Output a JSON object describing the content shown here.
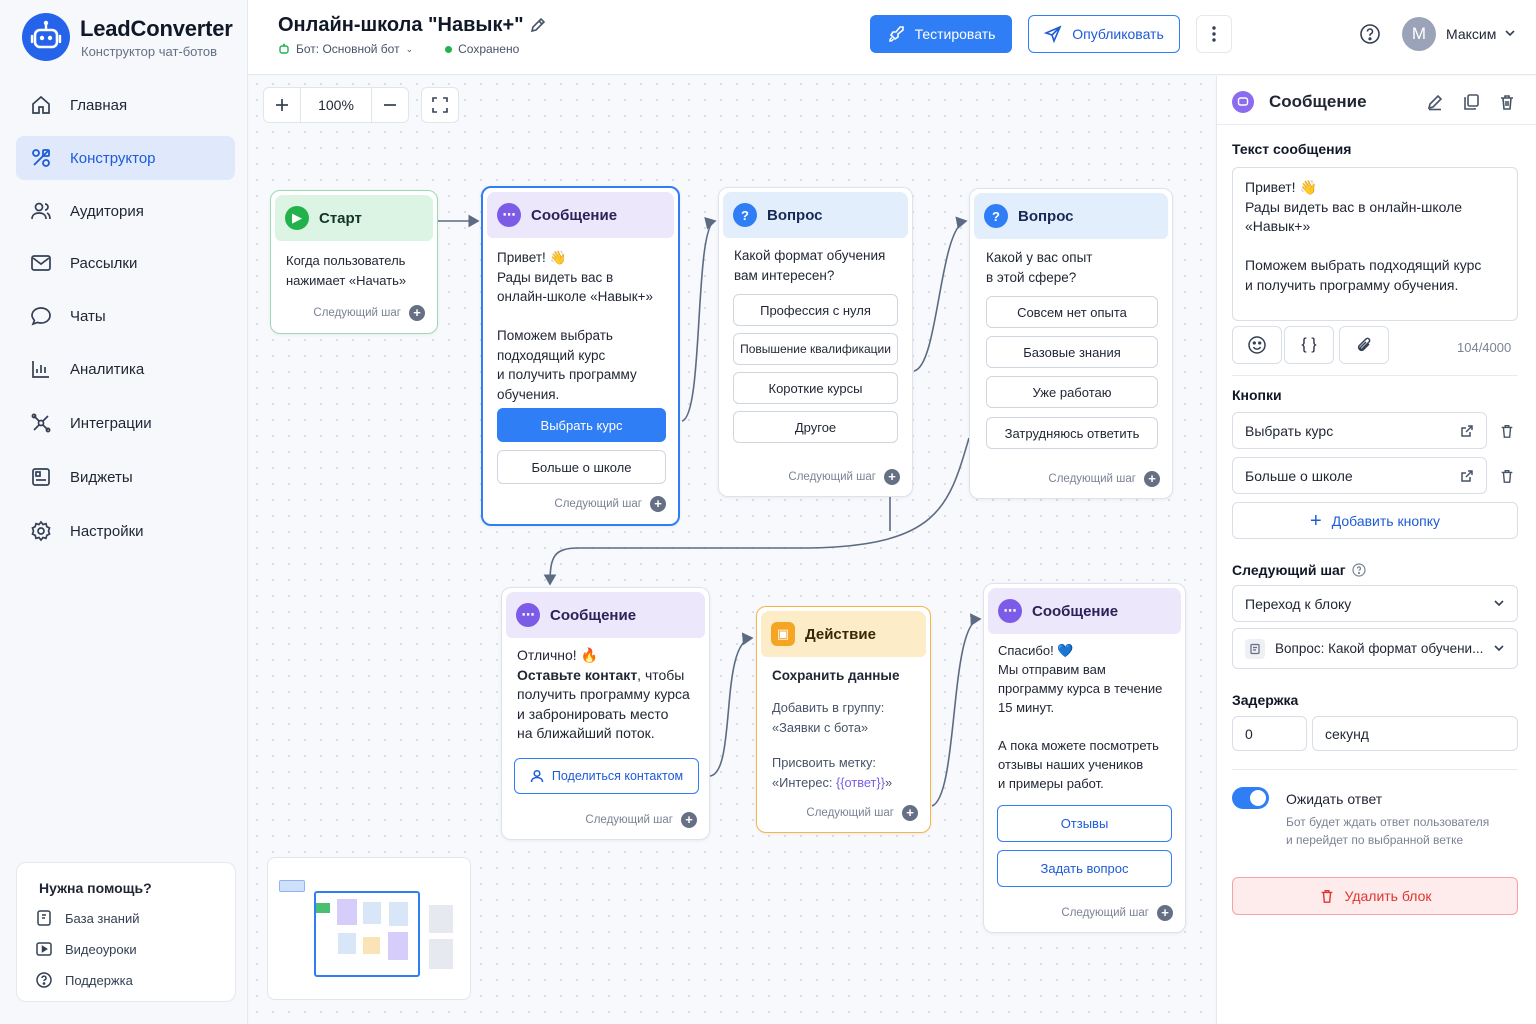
{
  "app": {
    "brand": "LeadConverter",
    "subtitle": "Конструктор чат-ботов"
  },
  "nav": [
    {
      "label": "Главная",
      "icon": "home-icon"
    },
    {
      "label": "Конструктор",
      "icon": "constructor-icon",
      "active": true
    },
    {
      "label": "Аудитория",
      "icon": "users-icon"
    },
    {
      "label": "Рассылки",
      "icon": "mail-icon"
    },
    {
      "label": "Чаты",
      "icon": "chat-icon"
    },
    {
      "label": "Аналитика",
      "icon": "chart-icon"
    },
    {
      "label": "Интеграции",
      "icon": "integrations-icon"
    },
    {
      "label": "Виджеты",
      "icon": "widgets-icon"
    },
    {
      "label": "Настройки",
      "icon": "settings-icon"
    }
  ],
  "help": {
    "title": "Нужна помощь?",
    "links": [
      "База знаний",
      "Видеоуроки",
      "Поддержка"
    ]
  },
  "header": {
    "title": "Онлайн-школа \"Навык+\"",
    "bot": "Бот: Основной бот",
    "status": "Сохранено",
    "test_label": "Тестировать",
    "publish_label": "Опубликовать",
    "user_initial": "М",
    "user_name": "Максим"
  },
  "canvas": {
    "zoom": "100%"
  },
  "nodes": {
    "start": {
      "title": "Старт",
      "text": "Когда пользователь\nнажимает «Начать»",
      "next": "Следующий шаг"
    },
    "msg1": {
      "title": "Сообщение",
      "text": "Привет! 👋\nРады видеть вас в\nонлайн-школе «Навык+»\n\nПоможем выбрать\nподходящий курс\nи получить программу\nобучения.",
      "buttons": [
        "Выбрать курс",
        "Больше о школе"
      ],
      "next": "Следующий шаг"
    },
    "q1": {
      "title": "Вопрос",
      "text": "Какой формат обучения\nвам интересен?",
      "options": [
        "Профессия с нуля",
        "Повышение квалификации",
        "Короткие курсы",
        "Другое"
      ],
      "next": "Следующий шаг"
    },
    "q2": {
      "title": "Вопрос",
      "text": "Какой у вас опыт\nв этой сфере?",
      "options": [
        "Совсем нет опыта",
        "Базовые знания",
        "Уже работаю",
        "Затрудняюсь ответить"
      ],
      "next": "Следующий шаг"
    },
    "msg2": {
      "title": "Сообщение",
      "line1": "Отлично! 🔥",
      "bold": "Оставьте контакт",
      "text": ", чтобы\nполучить программу курса\nи забронировать место\nна ближайший поток.",
      "button": "Поделиться контактом",
      "next": "Следующий шаг"
    },
    "action": {
      "title": "Действие",
      "subtitle": "Сохранить данные",
      "text1": "Добавить в группу:\n«Заявки с бота»",
      "text2a": "Присвоить метку:\n«Интерес: ",
      "var": "{{ответ}}",
      "text2b": "»",
      "next": "Следующий шаг"
    },
    "msg3": {
      "title": "Сообщение",
      "text": "Спасибо! 💙\nМы отправим вам\nпрограмму курса в течение\n15 минут.\n\nА пока можете посмотреть\nотзывы наших учеников\nи примеры работ.",
      "buttons": [
        "Отзывы",
        "Задать вопрос"
      ],
      "next": "Следующий шаг"
    }
  },
  "panel": {
    "title": "Сообщение",
    "text_label": "Текст сообщения",
    "text_value": "Привет! 👋\nРады видеть вас в онлайн-школе\n«Навык+»\n\nПоможем выбрать подходящий курс\nи получить программу обучения.",
    "char_count": "104/4000",
    "buttons_label": "Кнопки",
    "buttons": [
      "Выбрать курс",
      "Больше о школе"
    ],
    "add_button": "Добавить кнопку",
    "next_label": "Следующий шаг",
    "next_type": "Переход к блоку",
    "next_target": "Вопрос: Какой формат обучени...",
    "delay_label": "Задержка",
    "delay_value": "0",
    "delay_unit": "секунд",
    "wait_label": "Ожидать ответ",
    "wait_desc": "Бот будет ждать ответ пользователя\nи перейдет по выбранной ветке",
    "wait_enabled": true,
    "delete_label": "Удалить блок"
  }
}
